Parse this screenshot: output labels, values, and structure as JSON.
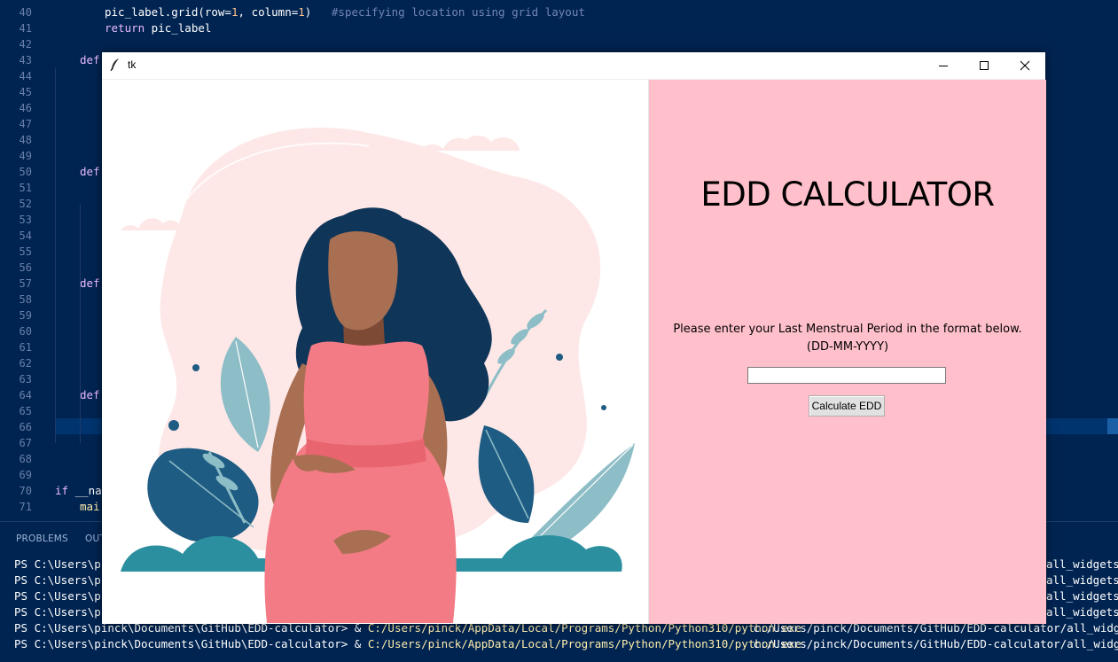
{
  "editor": {
    "lines": [
      {
        "num": "40",
        "indent": 56,
        "segments": [
          {
            "t": "pic_label.grid(row=",
            "c": ""
          },
          {
            "t": "1",
            "c": "num"
          },
          {
            "t": ", column=",
            "c": ""
          },
          {
            "t": "1",
            "c": "num"
          },
          {
            "t": ")   ",
            "c": ""
          },
          {
            "t": "#specifying location using grid layout",
            "c": "cm"
          }
        ]
      },
      {
        "num": "41",
        "indent": 56,
        "segments": [
          {
            "t": "return",
            "c": "kw"
          },
          {
            "t": " pic_label",
            "c": ""
          }
        ]
      },
      {
        "num": "42",
        "indent": 0,
        "segments": []
      },
      {
        "num": "43",
        "indent": 28,
        "segments": [
          {
            "t": "def",
            "c": "kw"
          }
        ]
      },
      {
        "num": "44",
        "indent": 0,
        "segments": []
      },
      {
        "num": "45",
        "indent": 0,
        "segments": []
      },
      {
        "num": "46",
        "indent": 0,
        "segments": []
      },
      {
        "num": "47",
        "indent": 0,
        "segments": []
      },
      {
        "num": "48",
        "indent": 0,
        "segments": []
      },
      {
        "num": "49",
        "indent": 0,
        "segments": []
      },
      {
        "num": "50",
        "indent": 28,
        "segments": [
          {
            "t": "def",
            "c": "kw"
          }
        ]
      },
      {
        "num": "51",
        "indent": 0,
        "segments": []
      },
      {
        "num": "52",
        "indent": 0,
        "segments": []
      },
      {
        "num": "53",
        "indent": 0,
        "segments": []
      },
      {
        "num": "54",
        "indent": 0,
        "segments": []
      },
      {
        "num": "55",
        "indent": 0,
        "segments": []
      },
      {
        "num": "56",
        "indent": 0,
        "segments": []
      },
      {
        "num": "57",
        "indent": 28,
        "segments": [
          {
            "t": "def",
            "c": "kw"
          }
        ]
      },
      {
        "num": "58",
        "indent": 0,
        "segments": []
      },
      {
        "num": "59",
        "indent": 0,
        "segments": []
      },
      {
        "num": "60",
        "indent": 0,
        "segments": []
      },
      {
        "num": "61",
        "indent": 0,
        "segments": []
      },
      {
        "num": "62",
        "indent": 0,
        "segments": []
      },
      {
        "num": "63",
        "indent": 0,
        "segments": []
      },
      {
        "num": "64",
        "indent": 28,
        "segments": [
          {
            "t": "def",
            "c": "kw"
          }
        ]
      },
      {
        "num": "65",
        "indent": 0,
        "segments": []
      },
      {
        "num": "66",
        "indent": 0,
        "segments": []
      },
      {
        "num": "67",
        "indent": 0,
        "segments": []
      },
      {
        "num": "68",
        "indent": 0,
        "segments": []
      },
      {
        "num": "69",
        "indent": 0,
        "segments": []
      },
      {
        "num": "70",
        "indent": 0,
        "segments": [
          {
            "t": "if",
            "c": "kw"
          },
          {
            "t": " __nam",
            "c": ""
          }
        ]
      },
      {
        "num": "71",
        "indent": 28,
        "segments": [
          {
            "t": "mai",
            "c": "fn"
          }
        ]
      }
    ]
  },
  "panel": {
    "tabs": [
      "PROBLEMS",
      "OUT"
    ],
    "terminal_lines": [
      {
        "prompt": "PS C:\\Users\\pi",
        "exe": "",
        "tail": "all_widgets."
      },
      {
        "prompt": "PS C:\\Users\\pi",
        "exe": "",
        "tail": "all_widgets."
      },
      {
        "prompt": "PS C:\\Users\\pi",
        "exe": "",
        "tail": "all_widgets."
      },
      {
        "prompt": "PS C:\\Users\\pi",
        "exe": "",
        "tail": "all_widgets."
      },
      {
        "prompt": "PS C:\\Users\\pinck\\Documents\\GitHub\\EDD-calculator> & ",
        "exe": "C:/Users/pinck/AppData/Local/Programs/Python/Python310/python.exe",
        "tail": " c:/Users/pinck/Documents/GitHub/EDD-calculator/all_widgets."
      },
      {
        "prompt": "PS C:\\Users\\pinck\\Documents\\GitHub\\EDD-calculator> & ",
        "exe": "C:/Users/pinck/AppData/Local/Programs/Python/Python310/python.exe",
        "tail": " c:/Users/pinck/Documents/GitHub/EDD-calculator/all_widgets."
      }
    ]
  },
  "window": {
    "title": "tk",
    "heading": "EDD CALCULATOR",
    "instruction_line1": "Please enter your Last Menstrual Period in the format below.",
    "instruction_line2": "(DD-MM-YYYY)",
    "entry_value": "",
    "button_label": "Calculate  EDD",
    "right_bg": "#ffc0cb"
  },
  "illustration": {
    "subject": "pregnant woman illustration with leaves",
    "skin": "#a86f52",
    "dress": "#f37b85",
    "hair": "#0f3558",
    "leaf_dark": "#1f5c83",
    "leaf_light": "#8dbdc6",
    "blob": "#fde8e7"
  }
}
